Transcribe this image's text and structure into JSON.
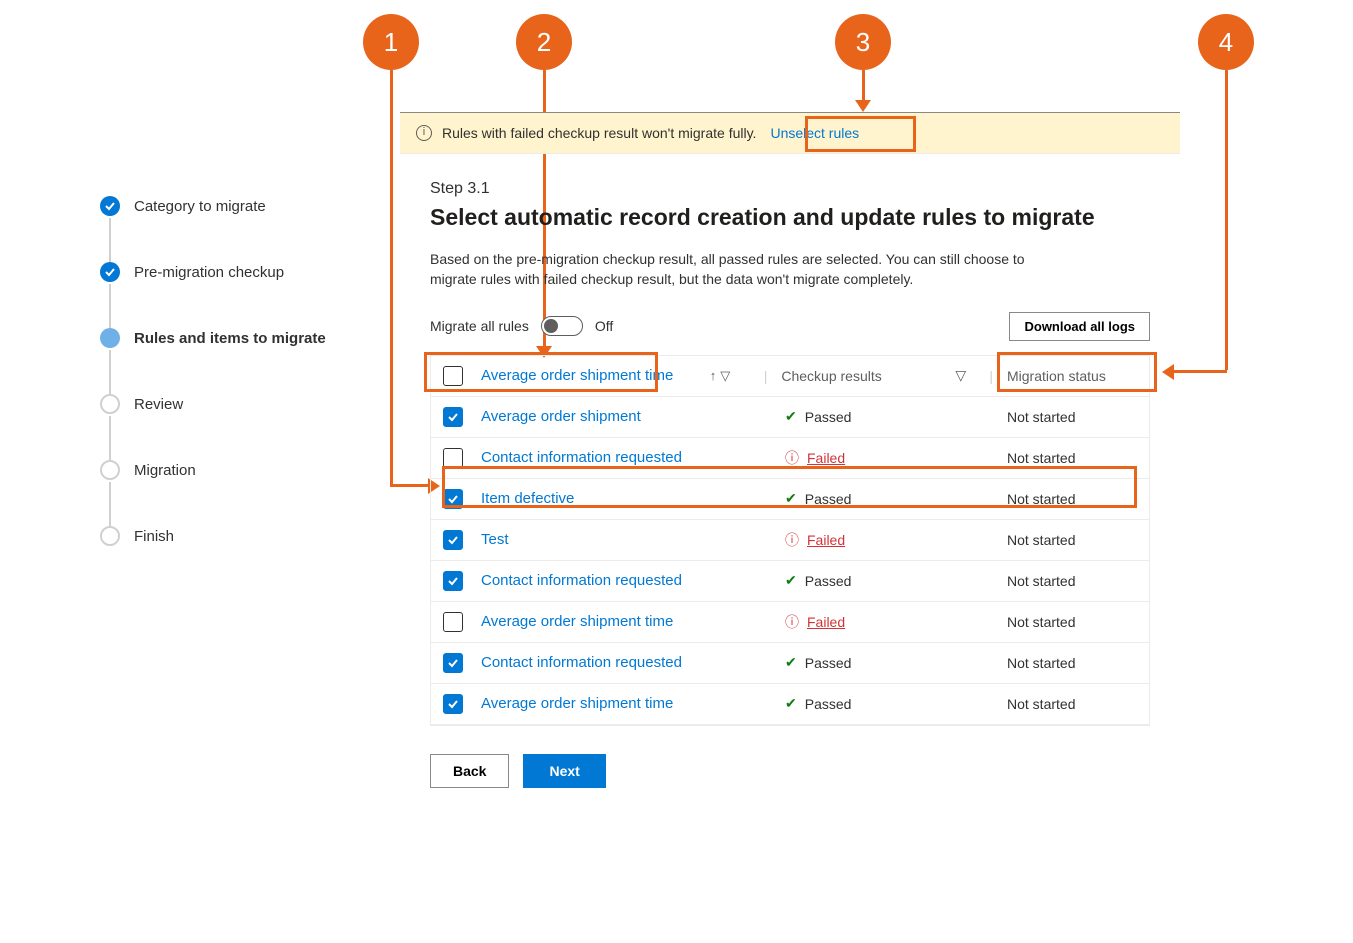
{
  "annotations": {
    "n1": "1",
    "n2": "2",
    "n3": "3",
    "n4": "4"
  },
  "sidebar": {
    "items": [
      {
        "label": "Category to migrate"
      },
      {
        "label": "Pre-migration checkup"
      },
      {
        "label": "Rules and items to migrate"
      },
      {
        "label": "Review"
      },
      {
        "label": "Migration"
      },
      {
        "label": "Finish"
      }
    ]
  },
  "banner": {
    "text": "Rules with failed checkup result won't migrate fully.",
    "link": "Unselect rules"
  },
  "header": {
    "step": "Step 3.1",
    "title": "Select automatic record creation and update rules to migrate",
    "desc": "Based on the pre-migration checkup result, all passed rules are selected. You can still choose to migrate rules with failed checkup result, but the data won't migrate completely."
  },
  "controls": {
    "toggle_label": "Migrate all rules",
    "toggle_state": "Off",
    "download": "Download all logs"
  },
  "table": {
    "header_name": "Average order shipment time",
    "header_result": "Checkup results",
    "header_status": "Migration status",
    "rows": [
      {
        "name": "Average order shipment",
        "checked": true,
        "result": "Passed",
        "status": "Not started"
      },
      {
        "name": "Contact information requested",
        "checked": false,
        "result": "Failed",
        "status": "Not started"
      },
      {
        "name": "Item defective",
        "checked": true,
        "result": "Passed",
        "status": "Not started"
      },
      {
        "name": "Test",
        "checked": true,
        "result": "Failed",
        "status": "Not started"
      },
      {
        "name": "Contact information requested",
        "checked": true,
        "result": "Passed",
        "status": "Not started"
      },
      {
        "name": "Average order shipment time",
        "checked": false,
        "result": "Failed",
        "status": "Not started"
      },
      {
        "name": "Contact information requested",
        "checked": true,
        "result": "Passed",
        "status": "Not started"
      },
      {
        "name": "Average order shipment time",
        "checked": true,
        "result": "Passed",
        "status": "Not started"
      }
    ]
  },
  "footer": {
    "back": "Back",
    "next": "Next"
  }
}
